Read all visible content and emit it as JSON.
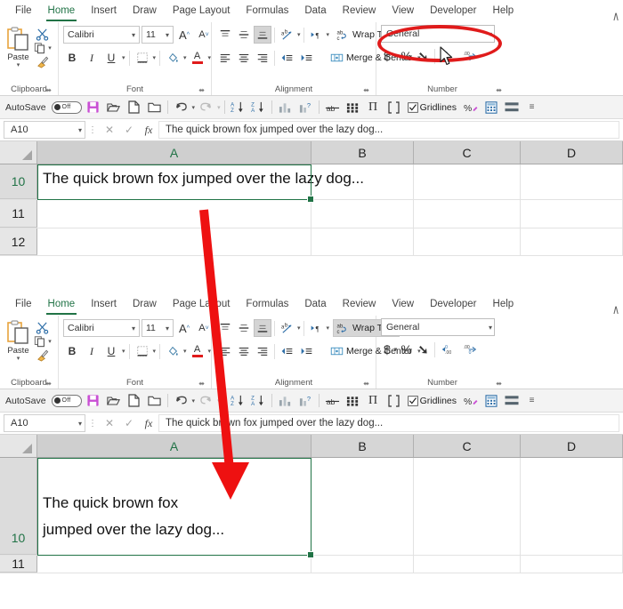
{
  "ribbon": {
    "tabs": [
      {
        "label": "File",
        "active": false
      },
      {
        "label": "Home",
        "active": true
      },
      {
        "label": "Insert",
        "active": false
      },
      {
        "label": "Draw",
        "active": false
      },
      {
        "label": "Page Layout",
        "active": false
      },
      {
        "label": "Formulas",
        "active": false
      },
      {
        "label": "Data",
        "active": false
      },
      {
        "label": "Review",
        "active": false
      },
      {
        "label": "View",
        "active": false
      },
      {
        "label": "Developer",
        "active": false
      },
      {
        "label": "Help",
        "active": false
      }
    ],
    "collapse_caret": "∧",
    "groups": {
      "clipboard": {
        "label": "Clipboard",
        "paste_label": "Paste",
        "paste_caret": "▾",
        "cut_icon": "scissors-icon",
        "copy_icon": "copy-icon",
        "format_painter_icon": "paintbrush-icon",
        "launcher": "⬌"
      },
      "font": {
        "label": "Font",
        "font_name": "Calibri",
        "font_size": "11",
        "grow_font": "A",
        "shrink_font": "A",
        "bold": "B",
        "italic": "I",
        "underline": "U",
        "borders_icon": "borders-icon",
        "fill_color_icon": "fill-color-icon",
        "font_color": "A",
        "caret": "▾",
        "launcher": "⬌"
      },
      "alignment": {
        "label": "Alignment",
        "align_top": "align-top",
        "align_middle": "align-middle",
        "align_bottom": "align-bottom",
        "orientation_icon": "orientation-icon",
        "rtl_icon": "text-direction-icon",
        "wrap_text_label": "Wrap Text",
        "wrap_text_icon": "wrap-text-icon",
        "merge_center_label": "Merge & Center",
        "merge_center_icon": "merge-center-icon",
        "align_left": "align-left",
        "align_center": "align-center",
        "align_right": "align-right",
        "decrease_indent": "decrease-indent",
        "increase_indent": "increase-indent",
        "caret": "▾",
        "launcher": "⬌"
      },
      "number": {
        "label": "Number",
        "format": "General",
        "caret": "▾",
        "currency": "$",
        "percent": "%",
        "comma": "➘",
        "increase_decimal": "increase-decimal-icon",
        "decrease_decimal": "decrease-decimal-icon",
        "launcher": "⬌"
      }
    }
  },
  "qat": {
    "autosave_label": "AutoSave",
    "autosave_state": "Off",
    "buttons": [
      {
        "name": "save-icon",
        "glyph": "save"
      },
      {
        "name": "open-icon",
        "glyph": "open"
      },
      {
        "name": "new-file-icon",
        "glyph": "new"
      },
      {
        "name": "folder-icon",
        "glyph": "folder"
      },
      {
        "name": "undo-icon",
        "glyph": "undo"
      },
      {
        "name": "redo-icon",
        "glyph": "redo"
      },
      {
        "name": "sort-ascending-icon",
        "glyph": "sortaz"
      },
      {
        "name": "sort-descending-icon",
        "glyph": "sortza"
      },
      {
        "name": "chart-icon",
        "glyph": "chart"
      },
      {
        "name": "chart-help-icon",
        "glyph": "charthelp"
      },
      {
        "name": "strikethrough-icon",
        "glyph": "strike"
      },
      {
        "name": "grid-small-icon",
        "glyph": "gridsmall"
      },
      {
        "name": "pi-icon",
        "glyph": "pi"
      },
      {
        "name": "bracket-icon",
        "glyph": "bracket"
      },
      {
        "name": "gridlines-checkbox",
        "glyph": "gridlines"
      },
      {
        "name": "percent-style-icon",
        "glyph": "percentstyle"
      },
      {
        "name": "calculator-icon",
        "glyph": "calculator"
      },
      {
        "name": "banded-icon",
        "glyph": "banded"
      },
      {
        "name": "qat-overflow-icon",
        "glyph": "overflow"
      }
    ],
    "gridlines_label": "Gridlines",
    "gridlines_checked": true
  },
  "formula_bar": {
    "name_box": "A10",
    "name_box_caret": "▾",
    "dots": "⋮",
    "cancel": "✕",
    "enter": "✓",
    "fx": "fx",
    "value": "The quick brown fox jumped over the lazy dog..."
  },
  "grid": {
    "columns": [
      "A",
      "B",
      "C",
      "D"
    ],
    "active_column": "A",
    "active_row": "10"
  },
  "panel_top": {
    "rows": [
      "10",
      "11",
      "12"
    ],
    "cell_a10": "The quick brown fox jumped over the lazy dog...",
    "wrap_enabled": false
  },
  "panel_bottom": {
    "rows": [
      "10",
      "11"
    ],
    "cell_a10_line1": "The quick brown fox",
    "cell_a10_line2": "jumped over the lazy dog...",
    "wrap_enabled": true
  },
  "annotations": {
    "highlight_ellipse": "red-ellipse-highlight",
    "flow_arrow": "red-down-arrow",
    "cursor": "mouse-pointer",
    "accent_red": "#e01b1b",
    "accent_green": "#217346"
  }
}
